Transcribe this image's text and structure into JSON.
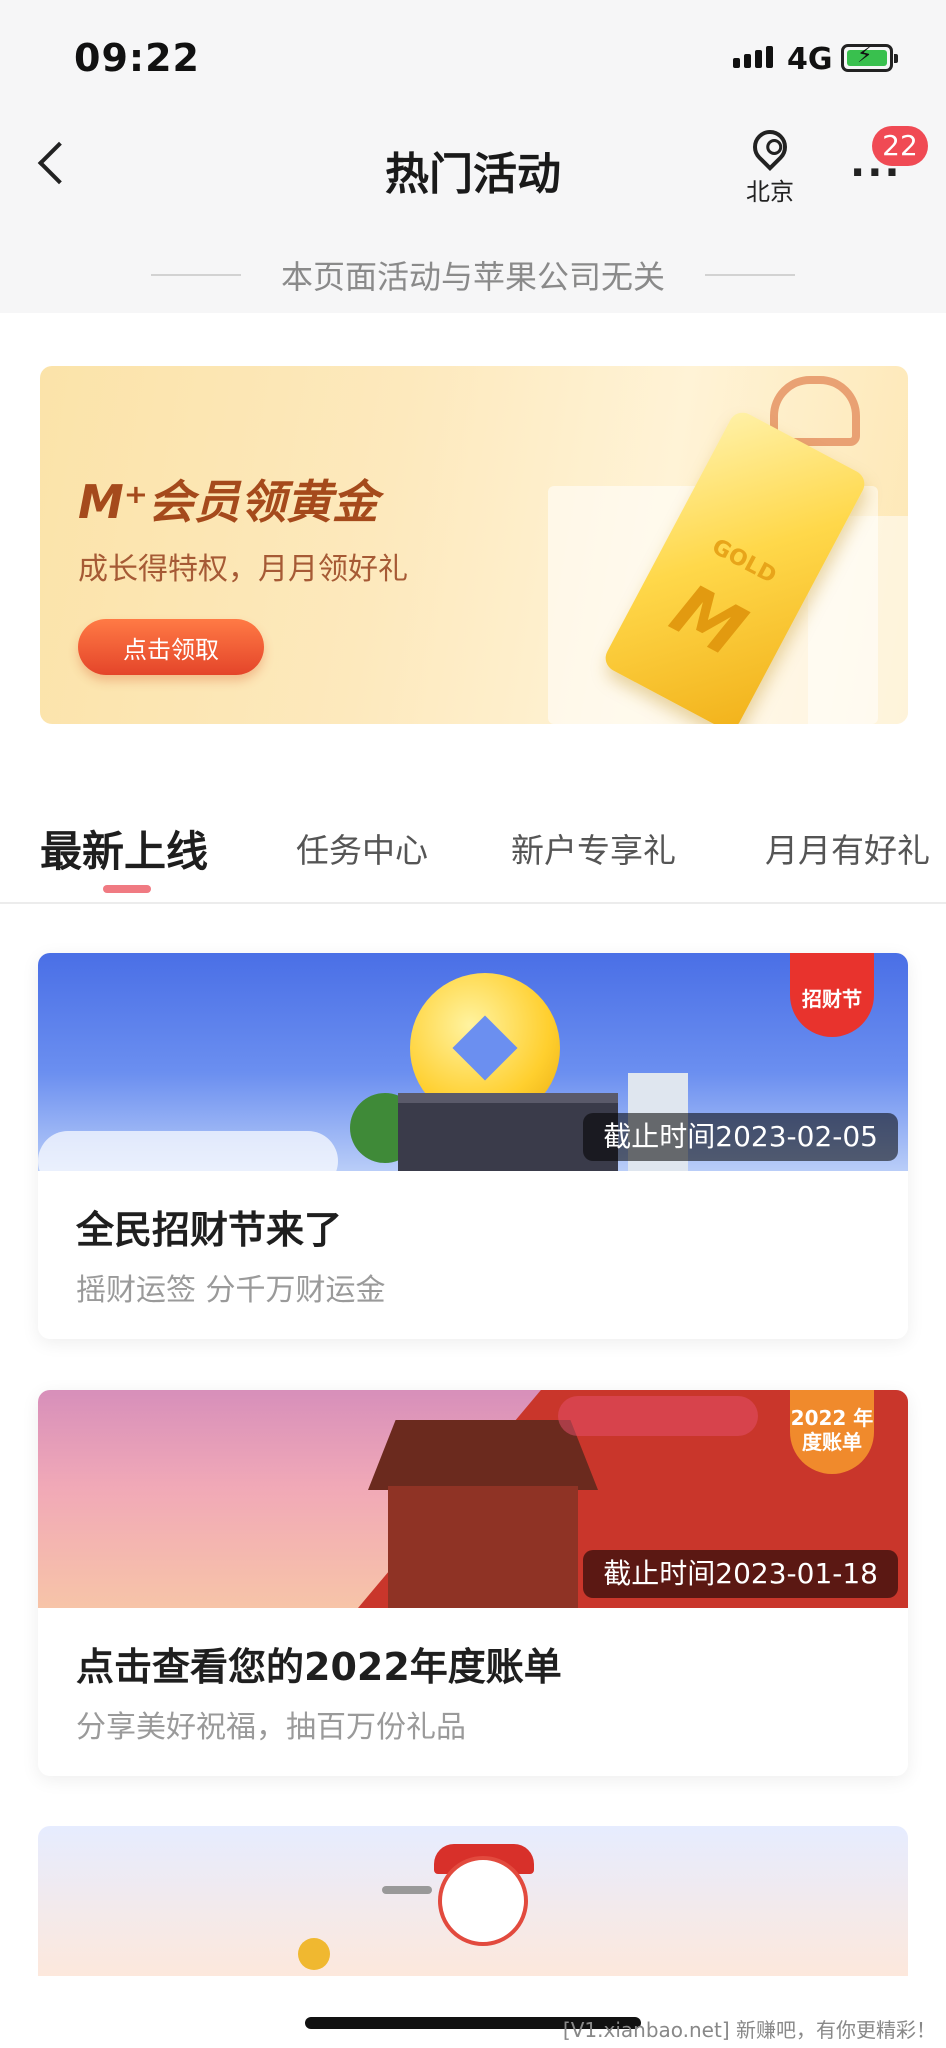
{
  "status_bar": {
    "time": "09:22",
    "network": "4G"
  },
  "nav": {
    "title": "热门活动",
    "location_label": "北京",
    "more_label": "···",
    "badge_count": "22"
  },
  "notice": "本页面活动与苹果公司无关",
  "banner": {
    "title": "M⁺会员领黄金",
    "subtitle": "成长得特权，月月领好礼",
    "button_label": "点击领取",
    "gold_text": "GOLD",
    "gold_mark": "M"
  },
  "tabs": [
    {
      "label": "最新上线",
      "active": true
    },
    {
      "label": "任务中心",
      "active": false
    },
    {
      "label": "新户专享礼",
      "active": false
    },
    {
      "label": "月月有好礼",
      "active": false
    }
  ],
  "cards": [
    {
      "deadline": "截止时间2023-02-05",
      "title": "全民招财节来了",
      "subtitle": "摇财运签 分千万财运金",
      "tag": "招财节"
    },
    {
      "deadline": "截止时间2023-01-18",
      "title": "点击查看您的2022年度账单",
      "subtitle": "分享美好祝福，抽百万份礼品",
      "tag": "2022 年度账单"
    }
  ],
  "watermark": "[V1.xianbao.net] 新赚吧，有你更精彩！",
  "colors": {
    "accent": "#f04a54",
    "banner_title": "#a54a1c",
    "button": "#e4452a",
    "tab_indicator": "#f07a82"
  },
  "icons": [
    "back-arrow-icon",
    "location-pin-icon",
    "more-icon",
    "signal-icon",
    "battery-icon"
  ]
}
